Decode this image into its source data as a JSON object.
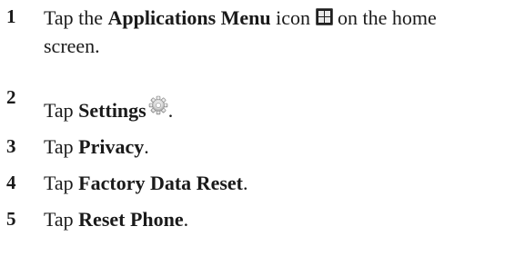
{
  "steps": [
    {
      "number": "1",
      "prefix": "Tap the ",
      "bold": "Applications Menu",
      "middle": " icon ",
      "icon": "apps-grid-icon",
      "suffix_line1": " on the home",
      "suffix_line2": "screen."
    },
    {
      "number": "2",
      "prefix": "Tap ",
      "bold": "Settings",
      "icon": "gear-icon",
      "suffix": "."
    },
    {
      "number": "3",
      "prefix": "Tap ",
      "bold": "Privacy",
      "suffix": "."
    },
    {
      "number": "4",
      "prefix": "Tap ",
      "bold": "Factory Data Reset",
      "suffix": "."
    },
    {
      "number": "5",
      "prefix": "Tap ",
      "bold": "Reset Phone",
      "suffix": "."
    }
  ]
}
